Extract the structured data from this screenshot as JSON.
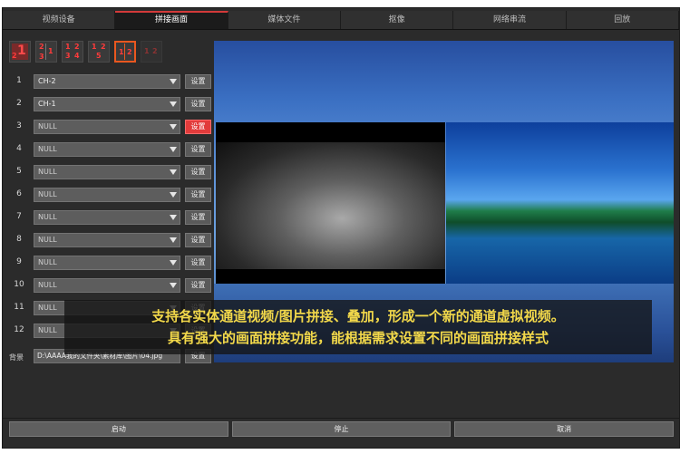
{
  "tabs": [
    {
      "label": "视频设备"
    },
    {
      "label": "拼接画面"
    },
    {
      "label": "媒体文件"
    },
    {
      "label": "抠像"
    },
    {
      "label": "网络串流"
    },
    {
      "label": "回放"
    }
  ],
  "active_tab": "拼接画面",
  "layout_icons": {
    "l1": {
      "big": "1",
      "small": "2"
    },
    "l2": {
      "a": "2",
      "b": "1",
      "c": "3"
    },
    "l3": {
      "a": "1",
      "b": "2",
      "c": "3",
      "d": "4"
    },
    "l4": {
      "a": "1",
      "b": "2",
      "c": "5"
    },
    "l5": {
      "a": "1",
      "b": "2"
    },
    "l6": {
      "a": "1",
      "b": "2"
    }
  },
  "channels": [
    {
      "num": "1",
      "value": "CH-2",
      "button": "设置"
    },
    {
      "num": "2",
      "value": "CH-1",
      "button": "设置"
    },
    {
      "num": "3",
      "value": "NULL",
      "button": "设置"
    },
    {
      "num": "4",
      "value": "NULL",
      "button": "设置"
    },
    {
      "num": "5",
      "value": "NULL",
      "button": "设置"
    },
    {
      "num": "6",
      "value": "NULL",
      "button": "设置"
    },
    {
      "num": "7",
      "value": "NULL",
      "button": "设置"
    },
    {
      "num": "8",
      "value": "NULL",
      "button": "设置"
    },
    {
      "num": "9",
      "value": "NULL",
      "button": "设置"
    },
    {
      "num": "10",
      "value": "NULL",
      "button": "设置"
    },
    {
      "num": "11",
      "value": "NULL",
      "button": "设置"
    },
    {
      "num": "12",
      "value": "NULL",
      "button": "设置"
    }
  ],
  "background": {
    "label": "背景",
    "path": "D:\\AAAA我的文件夹\\素材库\\图片\\04.jpg",
    "button": "设置"
  },
  "caption": {
    "line1": "支持各实体通道视频/图片拼接、叠加，形成一个新的通道虚拟视频。",
    "line2": "具有强大的画面拼接功能，能根据需求设置不同的画面拼接样式"
  },
  "bottom_buttons": {
    "start": "启动",
    "stop": "停止",
    "cancel": "取消"
  },
  "colors": {
    "accent": "#d33a3a",
    "highlight_button": "#e23b3b",
    "caption_text": "#f2d84a"
  }
}
